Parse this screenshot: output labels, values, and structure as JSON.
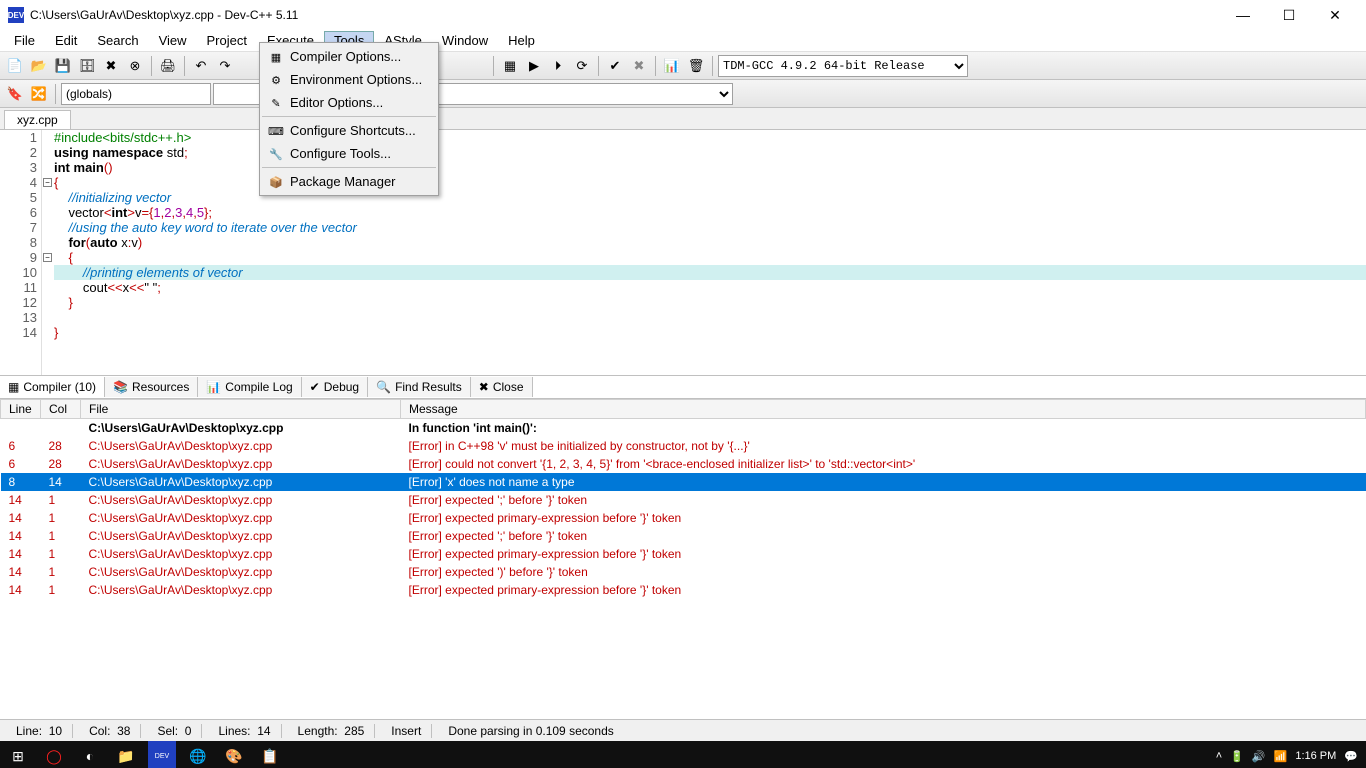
{
  "title": "C:\\Users\\GaUrAv\\Desktop\\xyz.cpp - Dev-C++ 5.11",
  "app_icon_text": "DEV",
  "menus": [
    "File",
    "Edit",
    "Search",
    "View",
    "Project",
    "Execute",
    "Tools",
    "AStyle",
    "Window",
    "Help"
  ],
  "active_menu_index": 6,
  "tools_menu": {
    "items": [
      {
        "icon": "▦",
        "label": "Compiler Options..."
      },
      {
        "icon": "⚙",
        "label": "Environment Options..."
      },
      {
        "icon": "✎",
        "label": "Editor Options..."
      },
      {
        "sep": true
      },
      {
        "icon": "⌨",
        "label": "Configure Shortcuts..."
      },
      {
        "icon": "🔧",
        "label": "Configure Tools..."
      },
      {
        "sep": true
      },
      {
        "icon": "📦",
        "label": "Package Manager"
      }
    ]
  },
  "compiler_dropdown": "TDM-GCC 4.9.2 64-bit Release",
  "globals_dropdown": "(globals)",
  "file_tab": "xyz.cpp",
  "code_lines": [
    {
      "n": 1,
      "html": "<span class='pp'>#include&lt;bits/stdc++.h&gt;</span>"
    },
    {
      "n": 2,
      "html": "<span class='kw'>using</span> <span class='kw'>namespace</span> std<span class='op'>;</span>"
    },
    {
      "n": 3,
      "html": "<span class='kw'>int</span> <span class='kw'>main</span><span class='op'>()</span>"
    },
    {
      "n": 4,
      "html": "<span class='op'>{</span>",
      "fold": true
    },
    {
      "n": 5,
      "html": "    <span class='cmt'>//initializing vector</span>"
    },
    {
      "n": 6,
      "html": "    vector<span class='op'>&lt;</span><span class='kw'>int</span><span class='op'>&gt;</span>v<span class='op'>={</span><span class='num'>1</span><span class='op'>,</span><span class='num'>2</span><span class='op'>,</span><span class='num'>3</span><span class='op'>,</span><span class='num'>4</span><span class='op'>,</span><span class='num'>5</span><span class='op'>};</span>"
    },
    {
      "n": 7,
      "html": "    <span class='cmt'>//using the auto key word to iterate over the vector</span>"
    },
    {
      "n": 8,
      "html": "    <span class='kw'>for</span><span class='op'>(</span><span class='kw'>auto</span> x<span class='op'>:</span>v<span class='op'>)</span>"
    },
    {
      "n": 9,
      "html": "    <span class='op'>{</span>",
      "fold": true
    },
    {
      "n": 10,
      "html": "        <span class='cmt'>//printing elements of vector</span>",
      "hl": true
    },
    {
      "n": 11,
      "html": "        cout<span class='op'>&lt;&lt;</span>x<span class='op'>&lt;&lt;</span><span class='str'>\" \"</span><span class='op'>;</span>"
    },
    {
      "n": 12,
      "html": "    <span class='op'>}</span>"
    },
    {
      "n": 13,
      "html": ""
    },
    {
      "n": 14,
      "html": "<span class='op'>}</span>"
    }
  ],
  "bottom_tabs": [
    {
      "icon": "▦",
      "label": "Compiler (10)",
      "active": true
    },
    {
      "icon": "📚",
      "label": "Resources"
    },
    {
      "icon": "📊",
      "label": "Compile Log"
    },
    {
      "icon": "✔",
      "label": "Debug"
    },
    {
      "icon": "🔍",
      "label": "Find Results"
    },
    {
      "icon": "✖",
      "label": "Close"
    }
  ],
  "err_headers": [
    "Line",
    "Col",
    "File",
    "Message"
  ],
  "err_rows": [
    {
      "line": "",
      "col": "",
      "file": "C:\\Users\\GaUrAv\\Desktop\\xyz.cpp",
      "msg": "In function 'int main()':",
      "cls": "hdr"
    },
    {
      "line": "6",
      "col": "28",
      "file": "C:\\Users\\GaUrAv\\Desktop\\xyz.cpp",
      "msg": "[Error] in C++98 'v' must be initialized by constructor, not by '{...}'",
      "cls": "err"
    },
    {
      "line": "6",
      "col": "28",
      "file": "C:\\Users\\GaUrAv\\Desktop\\xyz.cpp",
      "msg": "[Error] could not convert '{1, 2, 3, 4, 5}' from '<brace-enclosed initializer list>' to 'std::vector<int>'",
      "cls": "err"
    },
    {
      "line": "8",
      "col": "14",
      "file": "C:\\Users\\GaUrAv\\Desktop\\xyz.cpp",
      "msg": "[Error] 'x' does not name a type",
      "cls": "err sel"
    },
    {
      "line": "14",
      "col": "1",
      "file": "C:\\Users\\GaUrAv\\Desktop\\xyz.cpp",
      "msg": "[Error] expected ';' before '}' token",
      "cls": "err"
    },
    {
      "line": "14",
      "col": "1",
      "file": "C:\\Users\\GaUrAv\\Desktop\\xyz.cpp",
      "msg": "[Error] expected primary-expression before '}' token",
      "cls": "err"
    },
    {
      "line": "14",
      "col": "1",
      "file": "C:\\Users\\GaUrAv\\Desktop\\xyz.cpp",
      "msg": "[Error] expected ';' before '}' token",
      "cls": "err"
    },
    {
      "line": "14",
      "col": "1",
      "file": "C:\\Users\\GaUrAv\\Desktop\\xyz.cpp",
      "msg": "[Error] expected primary-expression before '}' token",
      "cls": "err"
    },
    {
      "line": "14",
      "col": "1",
      "file": "C:\\Users\\GaUrAv\\Desktop\\xyz.cpp",
      "msg": "[Error] expected ')' before '}' token",
      "cls": "err"
    },
    {
      "line": "14",
      "col": "1",
      "file": "C:\\Users\\GaUrAv\\Desktop\\xyz.cpp",
      "msg": "[Error] expected primary-expression before '}' token",
      "cls": "err"
    }
  ],
  "status": {
    "line_lbl": "Line:",
    "line": "10",
    "col_lbl": "Col:",
    "col": "38",
    "sel_lbl": "Sel:",
    "sel": "0",
    "lines_lbl": "Lines:",
    "lines": "14",
    "len_lbl": "Length:",
    "len": "285",
    "mode": "Insert",
    "parse": "Done parsing in 0.109 seconds"
  },
  "taskbar": {
    "time": "1:16 PM"
  }
}
